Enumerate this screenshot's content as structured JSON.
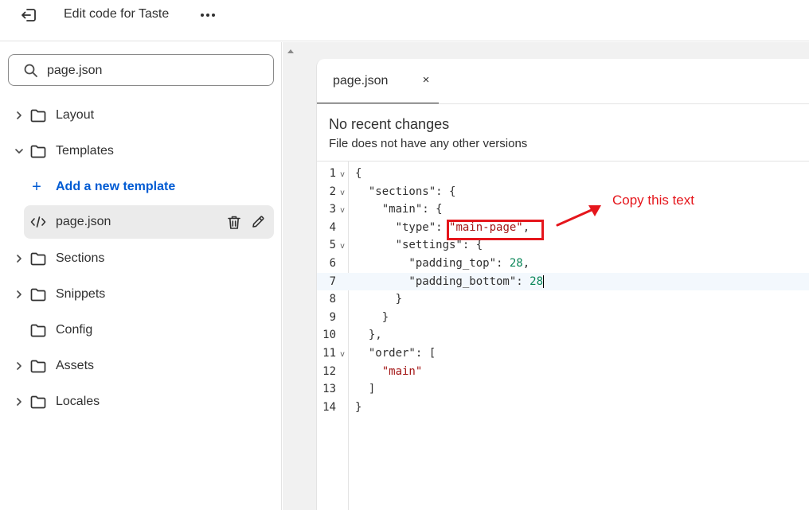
{
  "topbar": {
    "title": "Edit code for Taste",
    "exit_icon": "exit-icon",
    "more_icon": "more-horizontal-icon"
  },
  "sidebar": {
    "search": {
      "value": "page.json",
      "icon": "search-icon"
    },
    "folders": [
      {
        "label": "Layout",
        "expanded": false
      },
      {
        "label": "Templates",
        "expanded": true
      },
      {
        "label": "Sections",
        "expanded": false
      },
      {
        "label": "Snippets",
        "expanded": false
      },
      {
        "label": "Config",
        "expanded": false
      },
      {
        "label": "Assets",
        "expanded": false
      },
      {
        "label": "Locales",
        "expanded": false
      }
    ],
    "add_template_label": "Add a new template",
    "selected_file": "page.json"
  },
  "editor": {
    "tab_label": "page.json",
    "tab_close": "×",
    "changes_title": "No recent changes",
    "changes_subtitle": "File does not have any other versions",
    "line_numbers": [
      "1",
      "2",
      "3",
      "4",
      "5",
      "6",
      "7",
      "8",
      "9",
      "10",
      "11",
      "12",
      "13",
      "14"
    ],
    "active_line": 7
  },
  "annotation": {
    "text": "Copy this text",
    "color": "#e5161c"
  },
  "colors": {
    "accent_link": "#005bd3",
    "string": "#a31515",
    "number": "#098658",
    "annotation": "#e5161c"
  }
}
